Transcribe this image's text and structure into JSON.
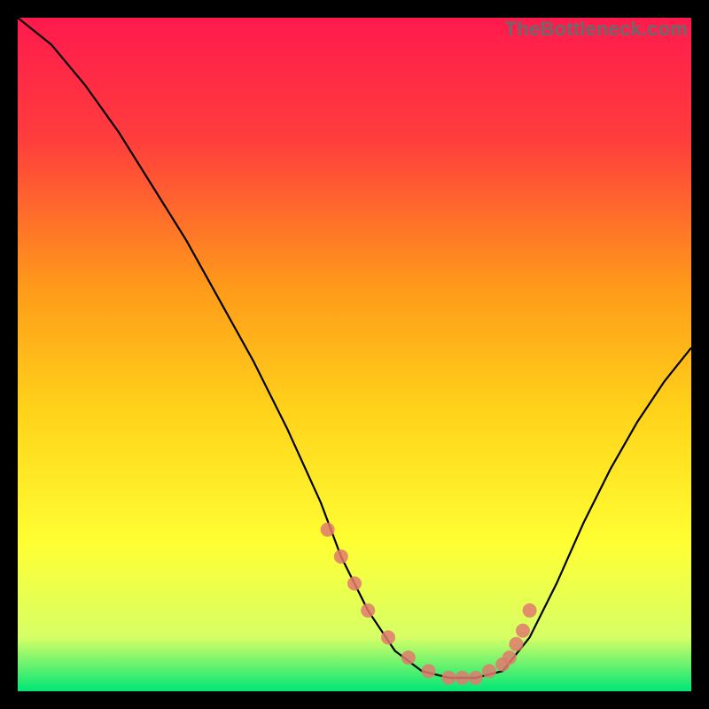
{
  "watermark": "TheBottleneck.com",
  "chart_data": {
    "type": "line",
    "title": "",
    "xlabel": "",
    "ylabel": "",
    "xlim": [
      0,
      100
    ],
    "ylim": [
      0,
      100
    ],
    "background_gradient": {
      "stops": [
        {
          "offset": 0.0,
          "color": "#ff1a4d"
        },
        {
          "offset": 0.18,
          "color": "#ff3d3d"
        },
        {
          "offset": 0.4,
          "color": "#ff9a1a"
        },
        {
          "offset": 0.58,
          "color": "#ffd21a"
        },
        {
          "offset": 0.78,
          "color": "#ffff33"
        },
        {
          "offset": 0.92,
          "color": "#d6ff66"
        },
        {
          "offset": 1.0,
          "color": "#00e676"
        }
      ]
    },
    "series": [
      {
        "name": "bottleneck-curve",
        "color": "#000000",
        "x": [
          0,
          5,
          10,
          15,
          20,
          25,
          30,
          35,
          40,
          45,
          48,
          52,
          56,
          60,
          64,
          68,
          72,
          76,
          80,
          84,
          88,
          92,
          96,
          100
        ],
        "y": [
          100,
          96,
          90,
          83,
          75,
          67,
          58,
          49,
          39,
          28,
          20,
          12,
          6,
          3,
          2,
          2,
          3,
          8,
          16,
          25,
          33,
          40,
          46,
          51
        ]
      }
    ],
    "markers": {
      "name": "highlighted-points",
      "color": "#e07a6f",
      "x": [
        46,
        48,
        50,
        52,
        55,
        58,
        61,
        64,
        66,
        68,
        70,
        72,
        73,
        74,
        75,
        76
      ],
      "y": [
        24,
        20,
        16,
        12,
        8,
        5,
        3,
        2,
        2,
        2,
        3,
        4,
        5,
        7,
        9,
        12
      ]
    }
  }
}
